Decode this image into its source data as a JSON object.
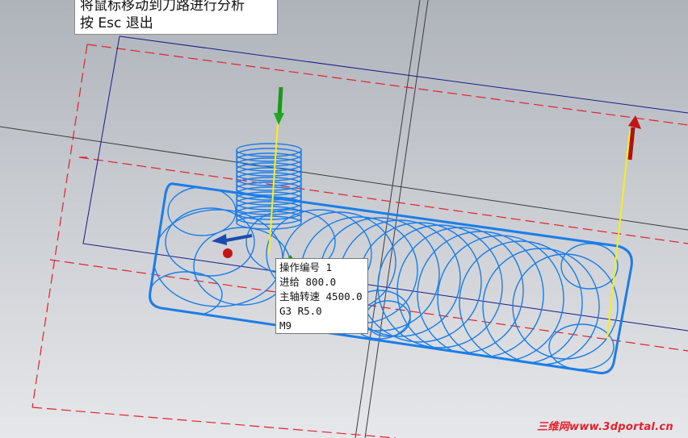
{
  "hint": {
    "line1": "将鼠标移动到刀路进行分析",
    "line2": "按 Esc 退出"
  },
  "tooltip": {
    "operation": "操作编号 1",
    "feed": "进给 800.0",
    "spindle": "主轴转速 4500.0",
    "arc": "G3 R5.0",
    "mcode": "M9"
  },
  "watermark": "三维网www.3dportal.cn",
  "colors": {
    "toolpath": "#1a7de8",
    "stock_outline": "#e0222a",
    "plane": "#1a1a8c",
    "arrow_red": "#b01010",
    "arrow_green": "#1a9a1a",
    "arrow_blue": "#1a4cb0",
    "tool_axis": "#f5ef1a"
  }
}
